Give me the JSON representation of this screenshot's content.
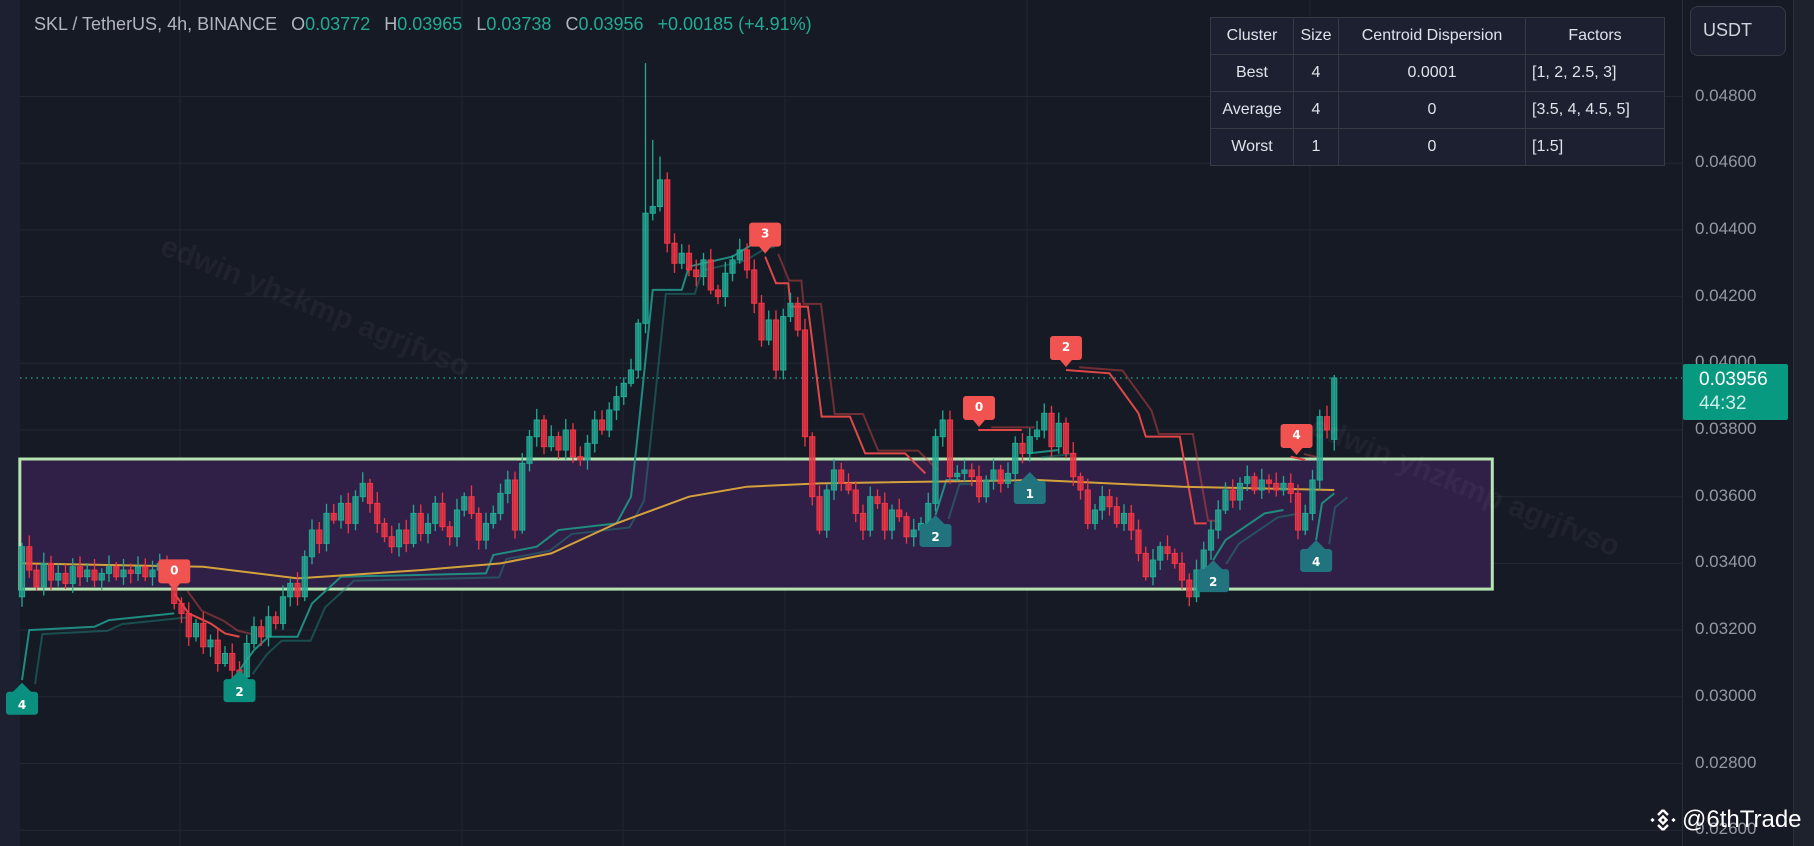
{
  "header": {
    "symbol": "SKL / TetherUS, 4h, BINANCE",
    "o_label": "O",
    "o": "0.03772",
    "h_label": "H",
    "h": "0.03965",
    "l_label": "L",
    "l": "0.03738",
    "c_label": "C",
    "c": "0.03956",
    "change": "+0.00185 (+4.91%)"
  },
  "currency_button": "USDT",
  "price_tag": {
    "price": "0.03956",
    "countdown": "44:32"
  },
  "cluster_table": {
    "headers": [
      "Cluster",
      "Size",
      "Centroid Dispersion",
      "Factors"
    ],
    "rows": [
      [
        "Best",
        "4",
        "0.0001",
        "[1, 2, 2.5, 3]"
      ],
      [
        "Average",
        "4",
        "0",
        "[3.5, 4, 4.5, 5]"
      ],
      [
        "Worst",
        "1",
        "0",
        "[1.5]"
      ]
    ]
  },
  "watermark": "edwin yhzkmp agrjfvso",
  "brand": "@6thTrade",
  "colors": {
    "up": "#22ab94",
    "down": "#f23645",
    "ma": "#d4a23c",
    "band_up": "#1f8c80",
    "band_down": "#e04848",
    "zone_border": "#b6e3b0",
    "zone_fill": "#33204a"
  },
  "chart_data": {
    "type": "candlestick",
    "title": "SKL / TetherUS, 4h, BINANCE",
    "ylabel": "USDT",
    "ylim": [
      0.0258,
      0.0504
    ],
    "y_ticks": [
      "0.04800",
      "0.04600",
      "0.04400",
      "0.04200",
      "0.04000",
      "0.03800",
      "0.03600",
      "0.03400",
      "0.03200",
      "0.03000",
      "0.02800",
      "0.02600"
    ],
    "last_price": 0.03956,
    "first_open": 0.033,
    "closes": [
      0.0345,
      0.0338,
      0.0333,
      0.034,
      0.0335,
      0.0337,
      0.0334,
      0.0339,
      0.0336,
      0.0338,
      0.0335,
      0.0337,
      0.0339,
      0.0336,
      0.0338,
      0.0337,
      0.0339,
      0.0336,
      0.0338,
      0.034,
      0.0337,
      0.0328,
      0.0325,
      0.0318,
      0.0322,
      0.0315,
      0.0317,
      0.031,
      0.0313,
      0.0308,
      0.0306,
      0.0316,
      0.0321,
      0.0318,
      0.0324,
      0.0322,
      0.033,
      0.0334,
      0.033,
      0.0342,
      0.035,
      0.0346,
      0.0355,
      0.0353,
      0.0358,
      0.0352,
      0.036,
      0.0364,
      0.0358,
      0.0352,
      0.0348,
      0.0345,
      0.035,
      0.0346,
      0.0355,
      0.0349,
      0.0352,
      0.0358,
      0.0351,
      0.0348,
      0.0356,
      0.036,
      0.0355,
      0.0347,
      0.0352,
      0.0355,
      0.0361,
      0.0365,
      0.035,
      0.037,
      0.0378,
      0.0383,
      0.0375,
      0.0378,
      0.0374,
      0.038,
      0.0372,
      0.0371,
      0.0376,
      0.0383,
      0.038,
      0.0386,
      0.039,
      0.0394,
      0.0398,
      0.0412,
      0.0445,
      0.0447,
      0.0455,
      0.0436,
      0.043,
      0.0433,
      0.0428,
      0.0426,
      0.0431,
      0.0422,
      0.042,
      0.0427,
      0.0431,
      0.0434,
      0.0428,
      0.0418,
      0.0407,
      0.0413,
      0.0398,
      0.0414,
      0.0418,
      0.041,
      0.0378,
      0.036,
      0.035,
      0.0362,
      0.0368,
      0.0364,
      0.0362,
      0.0355,
      0.035,
      0.036,
      0.0358,
      0.035,
      0.0356,
      0.0354,
      0.0348,
      0.035,
      0.0352,
      0.0358,
      0.0378,
      0.0383,
      0.0366,
      0.0367,
      0.0368,
      0.0366,
      0.036,
      0.0365,
      0.0368,
      0.0364,
      0.0367,
      0.0376,
      0.0373,
      0.0378,
      0.038,
      0.0385,
      0.0375,
      0.0382,
      0.0373,
      0.0366,
      0.0362,
      0.0352,
      0.0356,
      0.036,
      0.0357,
      0.0352,
      0.0355,
      0.035,
      0.0343,
      0.0336,
      0.0341,
      0.0345,
      0.0343,
      0.034,
      0.0335,
      0.033,
      0.0338,
      0.0344,
      0.035,
      0.0356,
      0.0362,
      0.0359,
      0.0364,
      0.0366,
      0.0362,
      0.0365,
      0.0364,
      0.0362,
      0.0364,
      0.0361,
      0.035,
      0.0355,
      0.0365,
      0.0384,
      0.038,
      0.03956
    ],
    "open_overrides": {
      "181": 0.03772
    },
    "high_overrides": {
      "86": 0.049,
      "87": 0.0467,
      "88": 0.0462,
      "181": 0.03965
    },
    "low_overrides": {
      "181": 0.03738
    },
    "moving_average": [
      [
        0,
        0.034
      ],
      [
        25,
        0.0339
      ],
      [
        38,
        0.03355
      ],
      [
        55,
        0.0338
      ],
      [
        66,
        0.034
      ],
      [
        73,
        0.0343
      ],
      [
        82,
        0.0352
      ],
      [
        92,
        0.036
      ],
      [
        100,
        0.0363
      ],
      [
        110,
        0.0364
      ],
      [
        140,
        0.0365
      ],
      [
        160,
        0.0363
      ],
      [
        181,
        0.0362
      ]
    ],
    "band_segments": [
      {
        "side": "up",
        "points": [
          [
            0,
            0.0305
          ],
          [
            1,
            0.032
          ],
          [
            10,
            0.0321
          ],
          [
            12,
            0.0323
          ],
          [
            21,
            0.0325
          ]
        ]
      },
      {
        "side": "down",
        "points": [
          [
            21,
            0.0331
          ],
          [
            23,
            0.0325
          ],
          [
            26,
            0.0322
          ],
          [
            28,
            0.0319
          ],
          [
            30,
            0.0318
          ]
        ]
      },
      {
        "side": "up",
        "points": [
          [
            30,
            0.0308
          ],
          [
            32,
            0.0314
          ],
          [
            34,
            0.0318
          ],
          [
            38,
            0.0318
          ],
          [
            40,
            0.0328
          ],
          [
            44,
            0.0336
          ],
          [
            64,
            0.0337
          ],
          [
            65,
            0.03425
          ],
          [
            71,
            0.0345
          ],
          [
            74,
            0.035
          ],
          [
            82,
            0.0352
          ],
          [
            84,
            0.036
          ],
          [
            85,
            0.038
          ],
          [
            87,
            0.0422
          ],
          [
            91,
            0.0422
          ],
          [
            92,
            0.0429
          ],
          [
            98,
            0.0432
          ],
          [
            101,
            0.0436
          ],
          [
            102,
            0.0436
          ]
        ]
      },
      {
        "side": "down",
        "points": [
          [
            102.5,
            0.0432
          ],
          [
            104,
            0.0424
          ],
          [
            105.7,
            0.0424
          ],
          [
            106,
            0.0417
          ],
          [
            108.4,
            0.0417
          ],
          [
            110.3,
            0.0384
          ],
          [
            114.2,
            0.0384
          ],
          [
            116.3,
            0.0373
          ],
          [
            121.8,
            0.0373
          ],
          [
            124.6,
            0.0367
          ]
        ]
      },
      {
        "side": "up",
        "points": [
          [
            126,
            0.03545
          ],
          [
            127.5,
            0.0365
          ],
          [
            129.4,
            0.0365
          ]
        ]
      },
      {
        "side": "down",
        "points": [
          [
            131.9,
            0.038
          ],
          [
            137.9,
            0.038
          ]
        ]
      },
      {
        "side": "up",
        "points": [
          [
            138.8,
            0.0373
          ],
          [
            143,
            0.0374
          ]
        ]
      },
      {
        "side": "down",
        "points": [
          [
            144,
            0.0398
          ],
          [
            150,
            0.0397
          ],
          [
            154,
            0.0385
          ],
          [
            155,
            0.0378
          ],
          [
            159.7,
            0.0378
          ],
          [
            161.8,
            0.0352
          ],
          [
            163.4,
            0.0352
          ]
        ]
      },
      {
        "side": "up",
        "points": [
          [
            164.3,
            0.0341
          ],
          [
            166,
            0.0347
          ],
          [
            171.4,
            0.0355
          ],
          [
            174,
            0.0356
          ]
        ]
      },
      {
        "side": "down",
        "points": [
          [
            175,
            0.0372
          ],
          [
            177,
            0.0371
          ]
        ]
      },
      {
        "side": "up",
        "points": [
          [
            178.5,
            0.0347
          ],
          [
            179.3,
            0.0358
          ],
          [
            181,
            0.0361
          ]
        ]
      }
    ],
    "zone": {
      "top": 0.03713,
      "bottom": 0.03323,
      "from_index": -0.3,
      "to_index": 202.8
    },
    "markers": [
      {
        "side": "up",
        "index": 0,
        "price": 0.03042,
        "label": "4",
        "color": "#0b8f7e"
      },
      {
        "side": "down",
        "index": 21,
        "price": 0.0331,
        "label": "0",
        "color": "#f05350"
      },
      {
        "side": "up",
        "index": 30,
        "price": 0.0308,
        "label": "2",
        "color": "#0b8f7e"
      },
      {
        "side": "down",
        "index": 102.5,
        "price": 0.0432,
        "label": "3",
        "color": "#f05350"
      },
      {
        "side": "up",
        "index": 126,
        "price": 0.03545,
        "label": "2",
        "color": "#21737e"
      },
      {
        "side": "down",
        "index": 132,
        "price": 0.038,
        "label": "0",
        "color": "#f05350"
      },
      {
        "side": "up",
        "index": 139,
        "price": 0.03674,
        "label": "1",
        "color": "#21737e"
      },
      {
        "side": "down",
        "index": 144,
        "price": 0.0398,
        "label": "2",
        "color": "#f05350"
      },
      {
        "side": "up",
        "index": 164.3,
        "price": 0.0341,
        "label": "2",
        "color": "#21737e"
      },
      {
        "side": "down",
        "index": 175.8,
        "price": 0.03716,
        "label": "4",
        "color": "#f05350"
      },
      {
        "side": "up",
        "index": 178.5,
        "price": 0.0347,
        "label": "4",
        "color": "#21737e"
      }
    ]
  }
}
